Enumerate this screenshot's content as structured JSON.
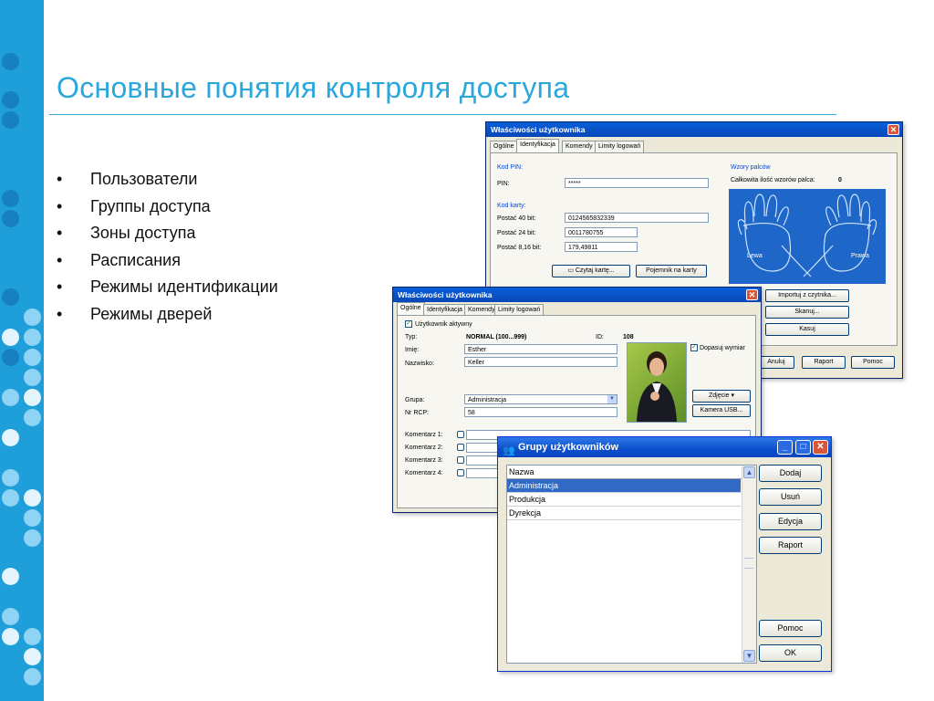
{
  "slide": {
    "title": "Основные понятия контроля доступа",
    "bullets": [
      "Пользователи",
      "Группы доступа",
      "Зоны доступа",
      "Расписания",
      "Режимы идентификации",
      "Режимы дверей"
    ]
  },
  "colors": {
    "accent": "#2aa7dc",
    "sidebar": "#1e9fd9",
    "xp_title": "#0a5fd8",
    "selection": "#316ac5"
  },
  "window_back": {
    "title": "Właściwości użytkownika",
    "tabs": [
      "Ogólne",
      "Identyfikacja",
      "Komendy",
      "Limity logowań"
    ],
    "pin_group": "Kod PIN:",
    "pin_label": "PIN:",
    "pin_value": "*****",
    "card_group": "Kod karty:",
    "card40_label": "Postać 40 bit:",
    "card40_value": "0124565832339",
    "card24_label": "Postać 24 bit:",
    "card24_value": "0011780755",
    "card816_label": "Postać 8,16 bit:",
    "card816_value": "179,49811",
    "read_card_btn": "Czytaj kartę...",
    "container_btn": "Pojemnik na karty",
    "finger_group": "Wzory palców",
    "finger_total_label": "Całkowita ilość wzorów palca:",
    "finger_total_value": "0",
    "left_hand": "Lewa",
    "right_hand": "Prawa",
    "import_btn": "Importuj z czytnika...",
    "scan_btn": "Skanuj...",
    "delete_btn": "Kasuj",
    "cancel_btn": "Anuluj",
    "report_btn": "Raport",
    "help_btn": "Pomoc"
  },
  "window_mid": {
    "title": "Właściwości użytkownika",
    "tabs": [
      "Ogólne",
      "Identyfikacja",
      "Komendy",
      "Limity logowań"
    ],
    "active_user_label": "Użytkownik aktywny",
    "type_label": "Typ:",
    "type_value": "NORMAL (100...999)",
    "id_label": "ID:",
    "id_value": "108",
    "first_name_label": "Imię:",
    "first_name_value": "Esther",
    "last_name_label": "Nazwisko:",
    "last_name_value": "Keller",
    "fit_label": "Dopasuj wymiar",
    "photo_btn": "Zdjęcie ▾",
    "camera_btn": "Kamera USB...",
    "group_label": "Grupa:",
    "group_value": "Administracja",
    "rcp_label": "Nr RCP:",
    "rcp_value": "58",
    "comments": [
      "Komentarz 1:",
      "Komentarz 2:",
      "Komentarz 3:",
      "Komentarz 4:"
    ]
  },
  "window_groups": {
    "title": "Grupy użytkowników",
    "column": "Nazwa",
    "rows": [
      "Administracja",
      "Produkcja",
      "Dyrekcja"
    ],
    "selected": "Administracja",
    "add_btn": "Dodaj",
    "remove_btn": "Usuń",
    "edit_btn": "Edycja",
    "report_btn": "Raport",
    "help_btn": "Pomoc",
    "ok_btn": "OK"
  }
}
